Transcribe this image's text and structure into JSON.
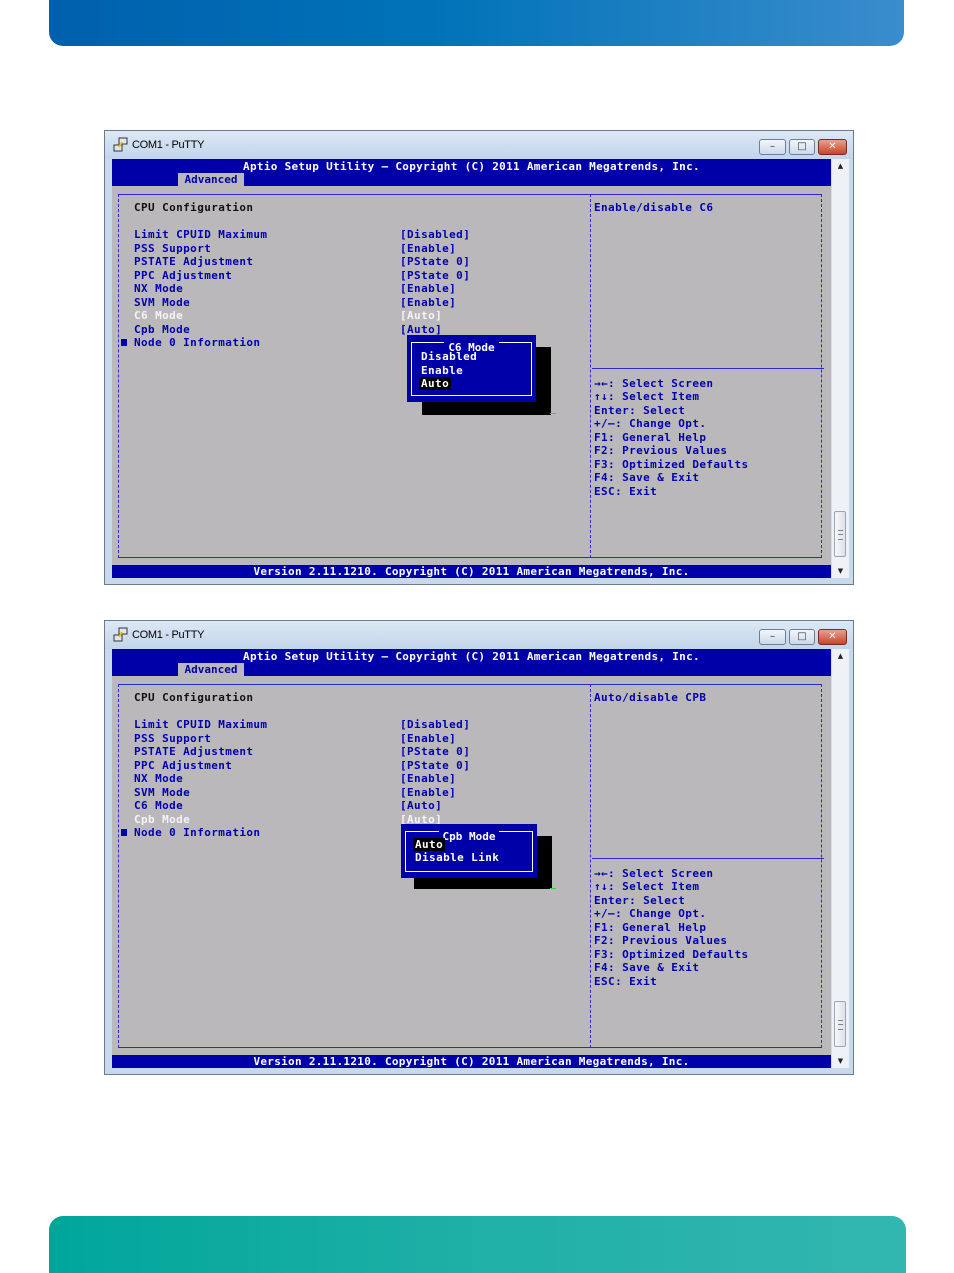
{
  "colors": {
    "top_band": "#0073b8",
    "bottom_band": "#1fb0a8",
    "bios_blue": "#0000a8",
    "bios_gray": "#bbb8bc"
  },
  "windows": [
    {
      "title": "COM1 - PuTTY",
      "controls": {
        "minimize": "–",
        "maximize": "□",
        "close": "✕"
      },
      "header_title": "Aptio Setup Utility – Copyright (C) 2011 American Megatrends, Inc.",
      "tab": "Advanced",
      "section_title": "CPU Configuration",
      "settings": [
        {
          "label": "Limit CPUID Maximum",
          "value": "[Disabled]",
          "state": "normal"
        },
        {
          "label": "PSS Support",
          "value": "[Enable]",
          "state": "normal"
        },
        {
          "label": "PSTATE Adjustment",
          "value": "[PState 0]",
          "state": "normal"
        },
        {
          "label": "PPC Adjustment",
          "value": "[PState 0]",
          "state": "normal"
        },
        {
          "label": "NX Mode",
          "value": "[Enable]",
          "state": "normal"
        },
        {
          "label": "SVM Mode",
          "value": "[Enable]",
          "state": "normal"
        },
        {
          "label": "C6 Mode",
          "value": "[Auto]",
          "state": "selected"
        },
        {
          "label": "Cpb Mode",
          "value": "[Auto]",
          "state": "normal"
        }
      ],
      "submenu": {
        "label": "Node 0 Information"
      },
      "help_text": "Enable/disable C6",
      "keys": [
        "→←: Select Screen",
        "↑↓: Select Item",
        "Enter: Select",
        "+/–: Change Opt.",
        "F1: General Help",
        "F2: Previous Values",
        "F3: Optimized Defaults",
        "F4: Save & Exit",
        "ESC: Exit"
      ],
      "popup": {
        "title": "C6 Mode",
        "options": [
          "Disabled",
          "Enable",
          "Auto"
        ],
        "selected_index": 2
      },
      "footer": "Version 2.11.1210. Copyright (C) 2011 American Megatrends, Inc."
    },
    {
      "title": "COM1 - PuTTY",
      "controls": {
        "minimize": "–",
        "maximize": "□",
        "close": "✕"
      },
      "header_title": "Aptio Setup Utility – Copyright (C) 2011 American Megatrends, Inc.",
      "tab": "Advanced",
      "section_title": "CPU Configuration",
      "settings": [
        {
          "label": "Limit CPUID Maximum",
          "value": "[Disabled]",
          "state": "normal"
        },
        {
          "label": "PSS Support",
          "value": "[Enable]",
          "state": "normal"
        },
        {
          "label": "PSTATE Adjustment",
          "value": "[PState 0]",
          "state": "normal"
        },
        {
          "label": "PPC Adjustment",
          "value": "[PState 0]",
          "state": "normal"
        },
        {
          "label": "NX Mode",
          "value": "[Enable]",
          "state": "normal"
        },
        {
          "label": "SVM Mode",
          "value": "[Enable]",
          "state": "normal"
        },
        {
          "label": "C6 Mode",
          "value": "[Auto]",
          "state": "normal"
        },
        {
          "label": "Cpb Mode",
          "value": "[Auto]",
          "state": "selected"
        }
      ],
      "submenu": {
        "label": "Node 0 Information"
      },
      "help_text": "Auto/disable CPB",
      "keys": [
        "→←: Select Screen",
        "↑↓: Select Item",
        "Enter: Select",
        "+/–: Change Opt.",
        "F1: General Help",
        "F2: Previous Values",
        "F3: Optimized Defaults",
        "F4: Save & Exit",
        "ESC: Exit"
      ],
      "popup": {
        "title": "Cpb Mode",
        "options": [
          "Auto",
          "Disable Link"
        ],
        "selected_index": 0
      },
      "footer": "Version 2.11.1210. Copyright (C) 2011 American Megatrends, Inc."
    }
  ]
}
